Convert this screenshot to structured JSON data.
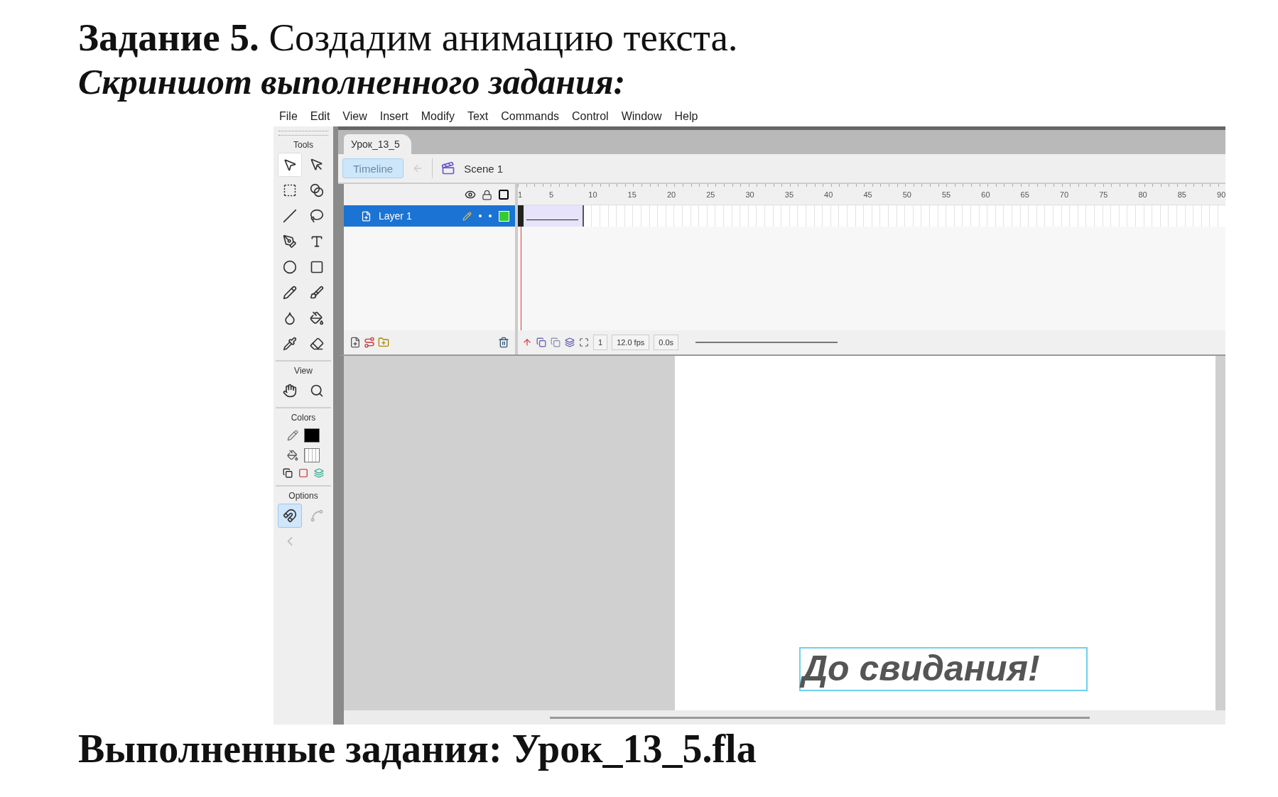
{
  "heading": {
    "task": "**Задание 5.** Создадим анимацию текста.",
    "subtitle": "Скриншот выполненного задания:"
  },
  "app": {
    "menu": [
      "File",
      "Edit",
      "View",
      "Insert",
      "Modify",
      "Text",
      "Commands",
      "Control",
      "Window",
      "Help"
    ],
    "tools_title": "Tools",
    "tools": [
      {
        "kind": "arrow",
        "selected": true
      },
      {
        "kind": "subselect",
        "selected": false
      },
      {
        "kind": "free-transform",
        "selected": false
      },
      {
        "kind": "gradient",
        "selected": false
      },
      {
        "kind": "line",
        "selected": false
      },
      {
        "kind": "lasso",
        "selected": false
      },
      {
        "kind": "pen",
        "selected": false
      },
      {
        "kind": "text",
        "selected": false
      },
      {
        "kind": "oval",
        "selected": false
      },
      {
        "kind": "rectangle",
        "selected": false
      },
      {
        "kind": "pencil",
        "selected": false
      },
      {
        "kind": "brush",
        "selected": false
      },
      {
        "kind": "ink-bottle",
        "selected": false
      },
      {
        "kind": "paint-bucket",
        "selected": false
      },
      {
        "kind": "eyedropper",
        "selected": false
      },
      {
        "kind": "eraser",
        "selected": false
      }
    ],
    "view_title": "View",
    "view_tools": [
      {
        "kind": "hand",
        "selected": false
      },
      {
        "kind": "zoom",
        "selected": false
      }
    ],
    "colors_title": "Colors",
    "options_title": "Options",
    "options": [
      {
        "kind": "magnet",
        "selected": true,
        "disabled": false
      },
      {
        "kind": "smooth",
        "selected": false,
        "disabled": true
      },
      {
        "kind": "straighten",
        "selected": false,
        "disabled": true
      }
    ],
    "document_tab": {
      "label": "Урок_13_5",
      "selected": true
    },
    "timeline_button": "Timeline",
    "scene": "Scene 1",
    "ruler": [
      "1",
      "5",
      "10",
      "15",
      "20",
      "25",
      "30",
      "35",
      "40",
      "45",
      "50",
      "55",
      "60",
      "65",
      "70",
      "75",
      "80",
      "85",
      "90"
    ],
    "layers": [
      {
        "name": "Layer 1",
        "selected": true,
        "color": "#33cc33"
      }
    ],
    "status": {
      "frame": "1",
      "fps": "12.0 fps",
      "time": "0.0s"
    },
    "stage_text": "До свидания!"
  },
  "footer": "Выполненные задания: Урок_13_5.fla"
}
